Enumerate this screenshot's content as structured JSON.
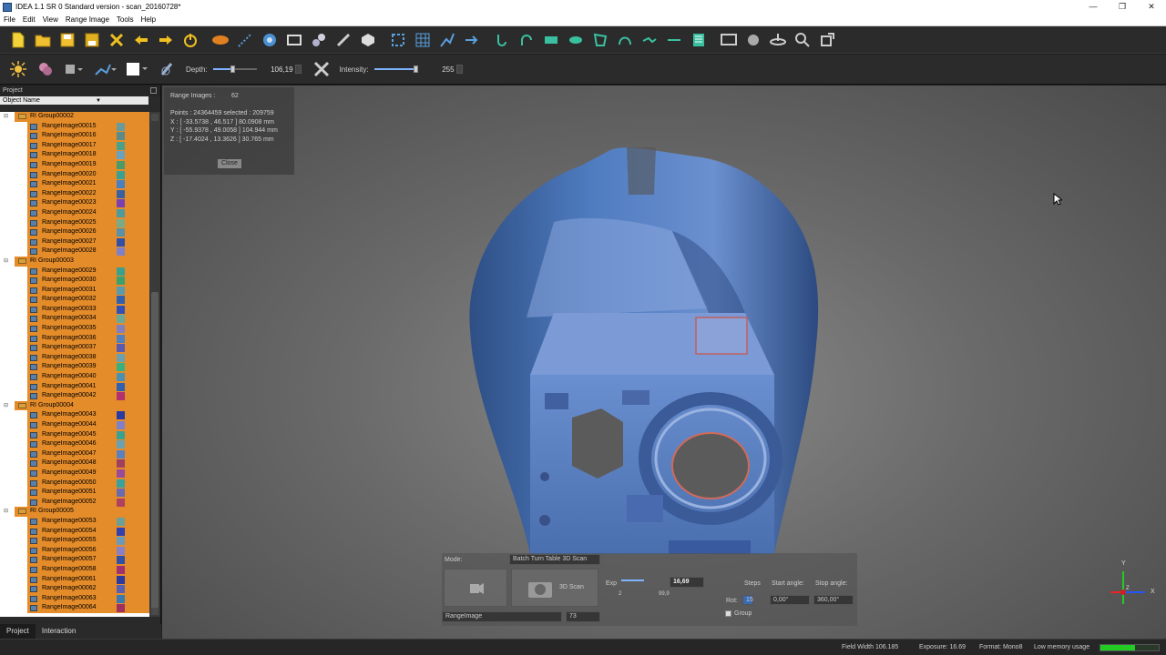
{
  "window": {
    "title": "IDEA 1.1 SR 0 Standard version - scan_20160728*",
    "controls": [
      "—",
      "❐",
      "✕"
    ]
  },
  "menu": [
    "File",
    "Edit",
    "View",
    "Range Image",
    "Tools",
    "Help"
  ],
  "toolbar2": {
    "depth_label": "Depth:",
    "depth_value": "106,19",
    "depth_level": 0.45,
    "intensity_label": "Intensity:",
    "intensity_value": "255",
    "intensity_level": 1.0
  },
  "project": {
    "panel_title": "Project",
    "column_header": "Object Name",
    "groups": [
      {
        "name": "RI Group00002",
        "items": [
          {
            "name": "RangeImage00015",
            "color": "#6a9a9a"
          },
          {
            "name": "RangeImage00016",
            "color": "#5a8a8a"
          },
          {
            "name": "RangeImage00017",
            "color": "#4aa08a"
          },
          {
            "name": "RangeImage00018",
            "color": "#6aa0c0"
          },
          {
            "name": "RangeImage00019",
            "color": "#4a9a6a"
          },
          {
            "name": "RangeImage00020",
            "color": "#3aa090"
          },
          {
            "name": "RangeImage00021",
            "color": "#4a80c0"
          },
          {
            "name": "RangeImage00022",
            "color": "#3a60a0"
          },
          {
            "name": "RangeImage00023",
            "color": "#7a40b0"
          },
          {
            "name": "RangeImage00024",
            "color": "#4a9aa0"
          },
          {
            "name": "RangeImage00025",
            "color": "#7aaa88"
          },
          {
            "name": "RangeImage00026",
            "color": "#5a90a8"
          },
          {
            "name": "RangeImage00027",
            "color": "#3050a8"
          },
          {
            "name": "RangeImage00028",
            "color": "#8080c8"
          }
        ]
      },
      {
        "name": "RI Group00003",
        "items": [
          {
            "name": "RangeImage00029",
            "color": "#3aa090"
          },
          {
            "name": "RangeImage00030",
            "color": "#3aa070"
          },
          {
            "name": "RangeImage00031",
            "color": "#5a9ab0"
          },
          {
            "name": "RangeImage00032",
            "color": "#3060b0"
          },
          {
            "name": "RangeImage00033",
            "color": "#3050b8"
          },
          {
            "name": "RangeImage00034",
            "color": "#6aa898"
          },
          {
            "name": "RangeImage00035",
            "color": "#8080c0"
          },
          {
            "name": "RangeImage00036",
            "color": "#5080c0"
          },
          {
            "name": "RangeImage00037",
            "color": "#5a5ab0"
          },
          {
            "name": "RangeImage00038",
            "color": "#6aa0b0"
          },
          {
            "name": "RangeImage00039",
            "color": "#3ab080"
          },
          {
            "name": "RangeImage00040",
            "color": "#4a90b0"
          },
          {
            "name": "RangeImage00041",
            "color": "#3060b0"
          },
          {
            "name": "RangeImage00042",
            "color": "#b03070"
          }
        ]
      },
      {
        "name": "RI Group00004",
        "items": [
          {
            "name": "RangeImage00043",
            "color": "#2a3aa0"
          },
          {
            "name": "RangeImage00044",
            "color": "#8080c8"
          },
          {
            "name": "RangeImage00045",
            "color": "#3aa090"
          },
          {
            "name": "RangeImage00046",
            "color": "#6aa0b0"
          },
          {
            "name": "RangeImage00047",
            "color": "#5a80c0"
          },
          {
            "name": "RangeImage00048",
            "color": "#a04060"
          },
          {
            "name": "RangeImage00049",
            "color": "#9a4a9a"
          },
          {
            "name": "RangeImage00050",
            "color": "#3aa0a0"
          },
          {
            "name": "RangeImage00051",
            "color": "#6a6ab0"
          },
          {
            "name": "RangeImage00052",
            "color": "#b04060"
          }
        ]
      },
      {
        "name": "RI Group00005",
        "items": [
          {
            "name": "RangeImage00053",
            "color": "#6aa098"
          },
          {
            "name": "RangeImage00054",
            "color": "#3040b0"
          },
          {
            "name": "RangeImage00055",
            "color": "#6a9ab8"
          },
          {
            "name": "RangeImage00056",
            "color": "#8a80c8"
          },
          {
            "name": "RangeImage00057",
            "color": "#3050a8"
          },
          {
            "name": "RangeImage00058",
            "color": "#a03070"
          },
          {
            "name": "RangeImage00061",
            "color": "#2a3aa0"
          },
          {
            "name": "RangeImage00062",
            "color": "#5a60b0"
          },
          {
            "name": "RangeImage00063",
            "color": "#3a7ab0"
          },
          {
            "name": "RangeImage00064",
            "color": "#a03060"
          }
        ]
      }
    ],
    "tabs": [
      "Project",
      "Interaction"
    ]
  },
  "info": {
    "range_images_label": "Range Images :",
    "range_images_value": "62",
    "points_line": "Points :   24364459   selected :   209759",
    "x_line": "X :  [ -33.5738 , 46.517 ]   80.0908 mm",
    "y_line": "Y :  [ -55.9378 , 49.0058 ]   104.944 mm",
    "z_line": "Z :  [ -17.4024 , 13.3626 ]   30.765 mm",
    "close_label": "Close"
  },
  "scan_panel": {
    "mode_label": "Mode:",
    "mode_value": "Batch Turn Table 3D Scan",
    "scan_label": "3D Scan",
    "exp_label": "Exp",
    "exp_value": "16,69",
    "exp_min": "2",
    "exp_max": "99,9",
    "steps_label": "Steps",
    "start_angle_label": "Start angle:",
    "stop_angle_label": "Stop angle:",
    "rot_label": "Rot:",
    "steps_value": "15",
    "start_angle_value": "0,00°",
    "stop_angle_value": "360,00°",
    "group_label": "Group",
    "target_value": "RangeImage",
    "target_number": "73"
  },
  "axes": {
    "x": "X",
    "y": "Y",
    "z": "Z"
  },
  "status": {
    "field_width": "Field Width 106.185",
    "exposure": "Exposure: 16.69",
    "format": "Format: Mono8",
    "memory": "Low memory usage",
    "memory_level": 0.6
  },
  "colors": {
    "selection_orange": "#e58c2a",
    "scan_blue": "#3f6aa8",
    "memory_green": "#22cc22"
  }
}
